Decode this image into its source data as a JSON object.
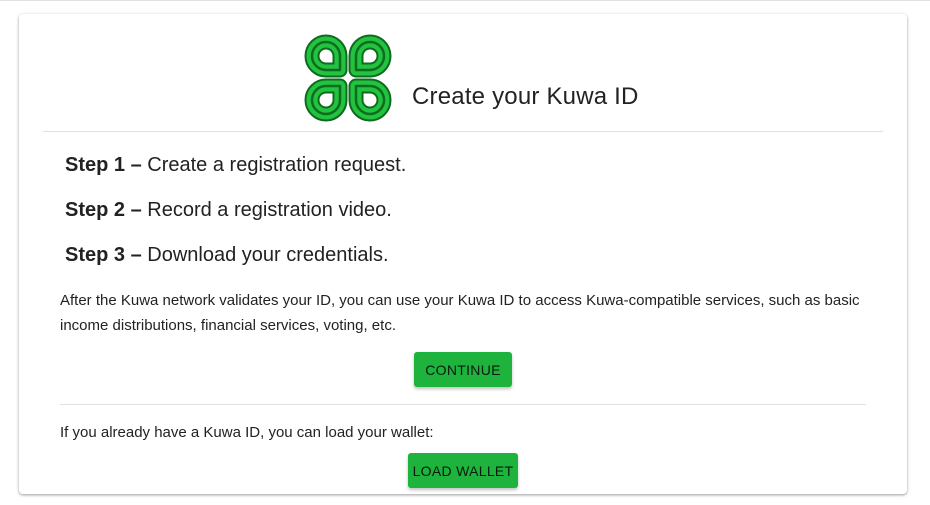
{
  "header": {
    "title": "Create your Kuwa ID",
    "logo_icon": "kuwa-clover-logo-icon",
    "brand_color": "#1db33c"
  },
  "steps": [
    {
      "number": "Step 1 –",
      "text": "Create a registration request."
    },
    {
      "number": "Step 2 –",
      "text": "Record a registration video."
    },
    {
      "number": "Step 3 –",
      "text": "Download your credentials."
    }
  ],
  "description": "After the Kuwa network validates your ID, you can use your Kuwa ID to access Kuwa-compatible services, such as basic income distributions, financial services, voting, etc.",
  "continue_button": {
    "label": "CONTINUE"
  },
  "wallet": {
    "prompt": "If you already have a Kuwa ID, you can load your wallet:",
    "load_button_label": "LOAD WALLET"
  }
}
